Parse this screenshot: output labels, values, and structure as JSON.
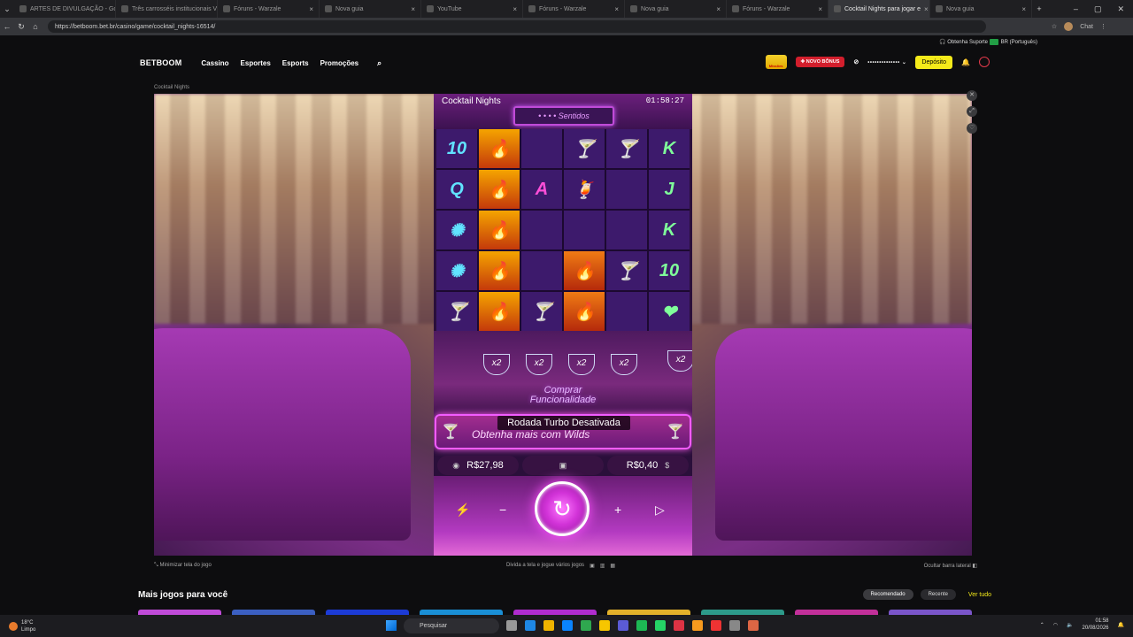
{
  "browser": {
    "tabs": [
      {
        "title": "ARTES DE DIVULGAÇÃO - Google",
        "active": false
      },
      {
        "title": "Três carrosséis institucionais Ve",
        "active": false
      },
      {
        "title": "Fóruns - Warzale",
        "active": false
      },
      {
        "title": "Nova guia",
        "active": false
      },
      {
        "title": "YouTube",
        "active": false
      },
      {
        "title": "Fóruns - Warzale",
        "active": false
      },
      {
        "title": "Nova guia",
        "active": false
      },
      {
        "title": "Fóruns - Warzale",
        "active": false
      },
      {
        "title": "Cocktail Nights para jogar e",
        "active": true
      },
      {
        "title": "Nova guia",
        "active": false
      }
    ],
    "url": "https://betboom.bet.br/casino/game/cocktail_nights-16514/",
    "chat_label": "Chat"
  },
  "site": {
    "support": "Obtenha Suporte",
    "language": "BR (Português)",
    "logo": "BETBOOM",
    "nav": [
      "Cassino",
      "Esportes",
      "Esports",
      "Promoções"
    ],
    "missions_label": "Missões",
    "bonus_button": "NOVO BÔNUS",
    "balance_masked": "••••••••••••••",
    "deposit_button": "Depósito",
    "breadcrumb": "Cocktail Nights"
  },
  "game": {
    "title": "Cocktail Nights",
    "clock": "01:58:27",
    "sign": "Sentidos",
    "reels": [
      [
        "10",
        "Q",
        "✺",
        "✺",
        "🍸"
      ],
      [
        "🔥",
        "🔥",
        "🔥",
        "🔥",
        "🔥"
      ],
      [
        "",
        "A",
        "",
        "",
        "🍸"
      ],
      [
        "🍸",
        "🍹",
        "",
        "🔥",
        "🔥"
      ],
      [
        "🍸",
        "",
        "",
        "🍸",
        ""
      ],
      [
        "K",
        "J",
        "K",
        "10",
        "❤"
      ]
    ],
    "multipliers": [
      "x2",
      "x2",
      "x2",
      "x2",
      "x2"
    ],
    "buy_feature": "Comprar Funcionalidade",
    "wilds_banner": "Obtenha mais com Wilds",
    "turbo_toast": "Rodada Turbo Desativada",
    "balance": "R$27,98",
    "bet": "R$0,40"
  },
  "game_bar": {
    "minimize": "Minimizar tela do jogo",
    "split": "Divida a tela e jogue vários jogos",
    "hide_sidebar": "Ocultar barra lateral"
  },
  "more_games": {
    "title": "Mais jogos para você",
    "filters": [
      "Recomendado",
      "Recente"
    ],
    "see_all": "Ver tudo",
    "thumb_colors": [
      "#c04bd8",
      "#3b5fc2",
      "#1c3bd6",
      "#1a8fd6",
      "#b02ccf",
      "#e3b12a",
      "#2d9a8a",
      "#c2309a",
      "#7a55c9"
    ]
  },
  "taskbar": {
    "temp": "18°C",
    "weather": "Limpo",
    "search": "Pesquisar",
    "time": "01:58",
    "date": "20/08/2026",
    "app_colors": [
      "#999",
      "#1e88e5",
      "#f0b400",
      "#0a84ff",
      "#2fa84f",
      "#f7c600",
      "#5b5bd6",
      "#1db954",
      "#25d366",
      "#d34",
      "#f79a1e",
      "#e33",
      "#888",
      "#d64"
    ]
  }
}
